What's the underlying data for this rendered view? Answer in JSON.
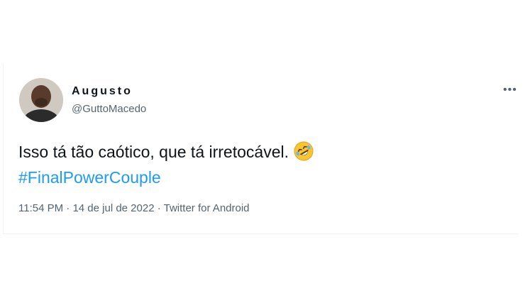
{
  "tweet": {
    "author": {
      "display_name": "Augusto",
      "handle": "@GuttoMacedo",
      "avatar_icon": "user-avatar"
    },
    "more_icon": "more-options-icon",
    "text": "Isso tá tão caótico, que tá irretocável.",
    "emoji": "rolling-on-floor-laughing-emoji",
    "hashtag": "#FinalPowerCouple",
    "time": "11:54 PM",
    "date": "14 de jul de 2022",
    "source": "Twitter for Android",
    "separator": "·",
    "colors": {
      "link": "#1d9bf0",
      "text": "#0f1419",
      "secondary": "#536471"
    }
  }
}
